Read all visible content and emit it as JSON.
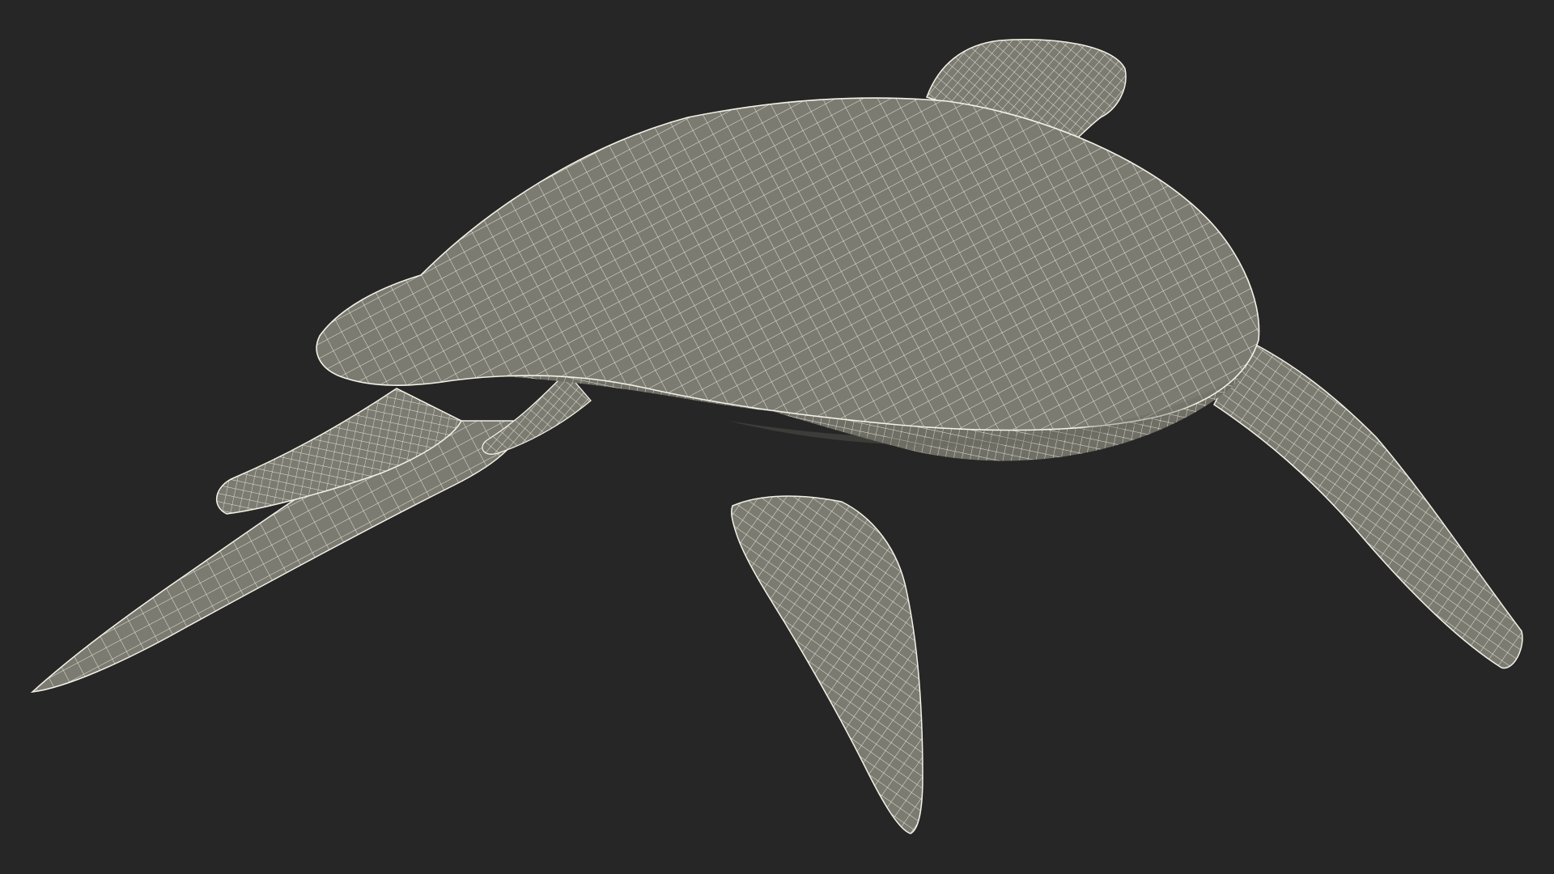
{
  "scene": {
    "subject_icon": "sea-turtle-wireframe-icon",
    "colors": {
      "background": "#262626",
      "surface": "#7b7b71",
      "surface_light": "#8a8a80",
      "surface_dark": "#66665e",
      "wire": "#f4f1e6"
    }
  }
}
